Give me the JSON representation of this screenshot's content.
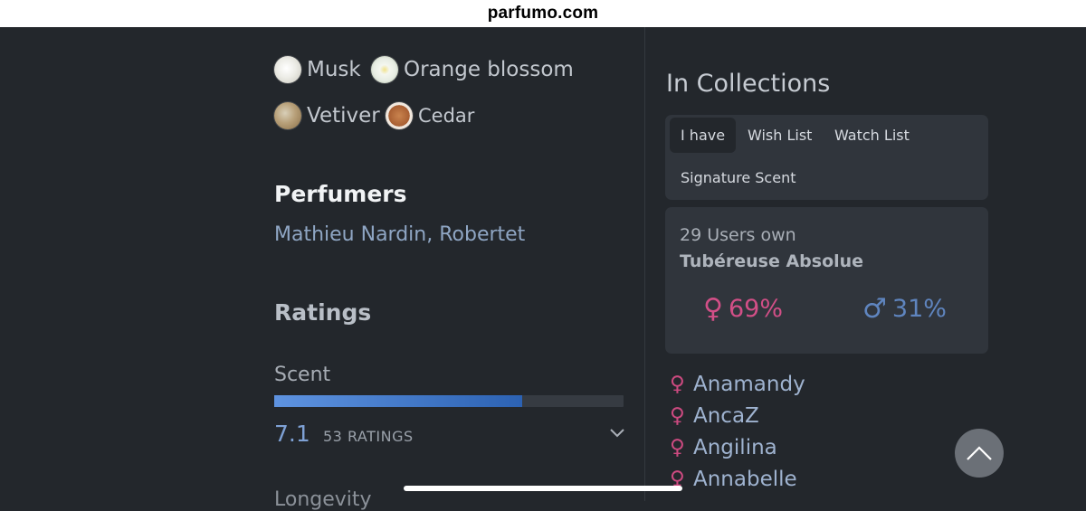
{
  "site": {
    "domain": "parfumo.com"
  },
  "notes": [
    {
      "label": "Musk",
      "icon": "musk-thumbnail"
    },
    {
      "label": "Orange blossom",
      "icon": "orange-blossom-thumbnail"
    },
    {
      "label": "Vetiver",
      "icon": "vetiver-thumbnail"
    },
    {
      "label": "Cedar",
      "icon": "cedar-thumbnail"
    }
  ],
  "perfumers": {
    "title": "Perfumers",
    "names": "Mathieu Nardin, Robertet"
  },
  "ratings": {
    "title": "Ratings",
    "scent": {
      "label": "Scent",
      "score": "7.1",
      "count": "53 RATINGS",
      "fill_fraction": 0.71
    },
    "next_label": "Longevity"
  },
  "collections": {
    "title": "In Collections",
    "tabs": [
      "I have",
      "Wish List",
      "Watch List",
      "Signature Scent"
    ],
    "active_tab": "I have",
    "summary": {
      "users_own": "29 Users own",
      "perfume_name": "Tubéreuse Absolue",
      "female_pct": "69%",
      "male_pct": "31%"
    },
    "users": [
      "Anamandy",
      "AncaZ",
      "Angilina",
      "Annabelle"
    ]
  },
  "colors": {
    "female": "#d24f87",
    "male": "#5f85bf",
    "accent_bar": "#2c62b3"
  }
}
